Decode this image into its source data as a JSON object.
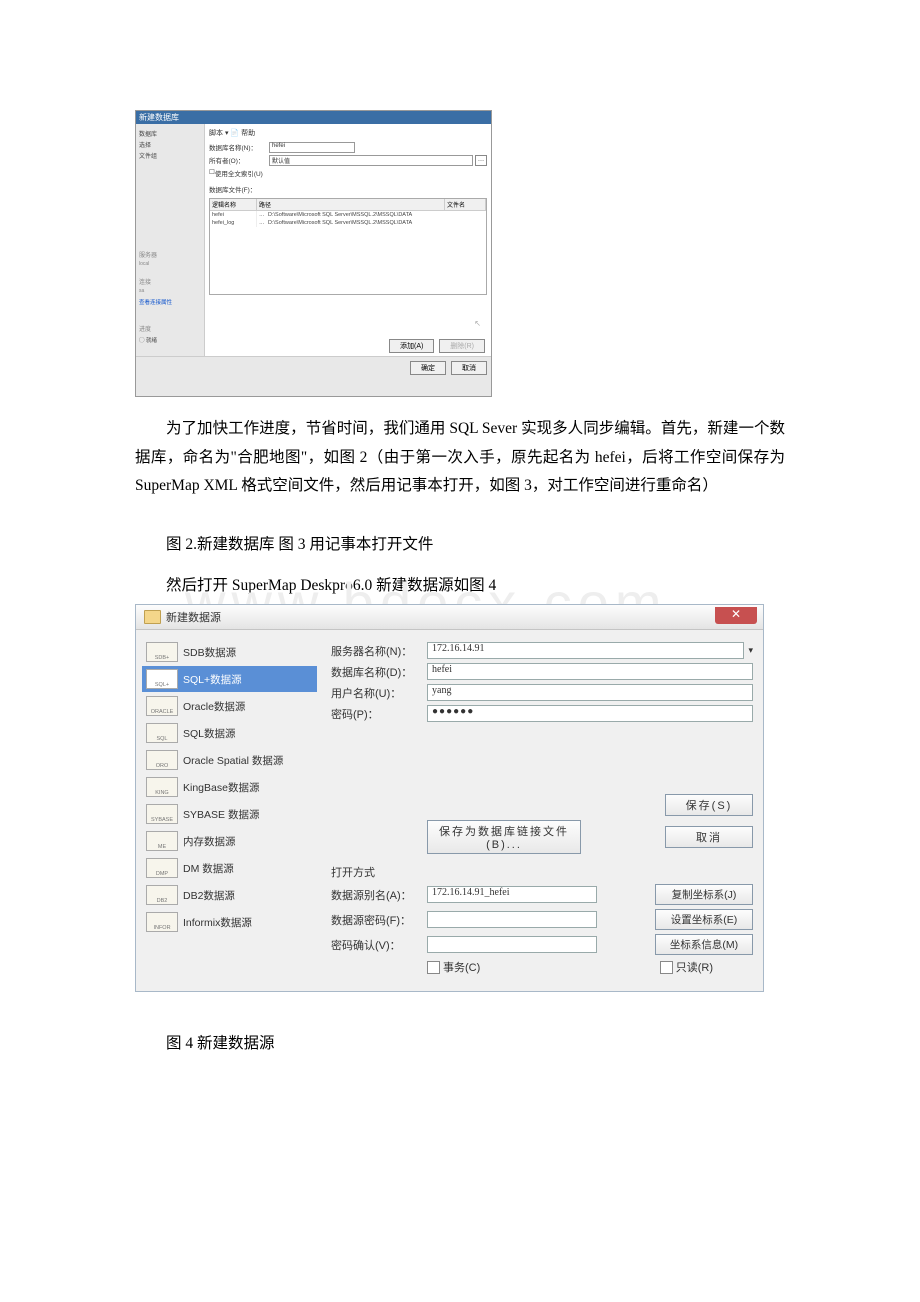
{
  "fig1": {
    "window_title": "新建数据库",
    "tree": [
      "数据库",
      "选择",
      "文件组"
    ],
    "tabs": "脚本 ▾ 📄 帮助",
    "form": {
      "name_label": "数据库名称(N)：",
      "name_value": "hefei",
      "owner_label": "所有者(O)：",
      "owner_value": "默认值",
      "fulltext_label": "使用全文索引(U)",
      "files_label": "数据库文件(F)："
    },
    "cols": {
      "logic": "逻辑名称",
      "type": "路径",
      "size": "文件名"
    },
    "rows": [
      {
        "n": "hefei",
        "p": "D:\\Software\\Microsoft SQL Server\\MSSQL.2\\MSSQL\\DATA"
      },
      {
        "n": "hefei_log",
        "p": "D:\\Software\\Microsoft SQL Server\\MSSQL.2\\MSSQL\\DATA"
      }
    ],
    "left2": {
      "srv": "服务器",
      "local": "连接",
      "adm": "sa",
      "view": "查看连接属性",
      "prog": "就绪"
    },
    "btns": {
      "add": "添加(A)",
      "del": "删除(R)",
      "ok": "确定",
      "cancel": "取消"
    }
  },
  "para1": "为了加快工作进度，节省时间，我们通用 SQL Sever 实现多人同步编辑。首先，新建一个数据库，命名为\"合肥地图\"，如图 2（由于第一次入手，原先起名为 hefei，后将工作空间保存为 SuperMap XML 格式空间文件，然后用记事本打开，如图 3，对工作空间进行重命名）",
  "cap_23": "图 2.新建数据库 图 3 用记事本打开文件",
  "para2": "然后打开 SuperMap Deskpro6.0 新建数据源如图 4",
  "watermark": "www.bdocx.com",
  "fig4": {
    "title": "新建数据源",
    "close": "✕",
    "ds_list": [
      {
        "icon": "SDB+",
        "label": "SDB数据源"
      },
      {
        "icon": "SQL+",
        "label": "SQL+数据源"
      },
      {
        "icon": "ORACLE",
        "label": "Oracle数据源"
      },
      {
        "icon": "SQL",
        "label": "SQL数据源"
      },
      {
        "icon": "ORO",
        "label": "Oracle Spatial 数据源"
      },
      {
        "icon": "KING",
        "label": "KingBase数据源"
      },
      {
        "icon": "SYBASE",
        "label": "SYBASE 数据源"
      },
      {
        "icon": "ME",
        "label": "内存数据源"
      },
      {
        "icon": "DMP",
        "label": "DM 数据源"
      },
      {
        "icon": "DB2",
        "label": "DB2数据源"
      },
      {
        "icon": "INFOR",
        "label": "Informix数据源"
      }
    ],
    "labels": {
      "server": "服务器名称(N)：",
      "server_v": "172.16.14.91",
      "db": "数据库名称(D)：",
      "db_v": "hefei",
      "user": "用户名称(U)：",
      "user_v": "yang",
      "pwd": "密码(P)：",
      "pwd_v": "●●●●●●",
      "save": "保存(S)",
      "cancel": "取消",
      "savelink": "保存为数据库链接文件(B)...",
      "open": "打开方式",
      "alias": "数据源别名(A)：",
      "alias_v": "172.16.14.91_hefei",
      "dspwd": "数据源密码(F)：",
      "pwdcfm": "密码确认(V)：",
      "copy": "复制坐标系(J)",
      "set": "设置坐标系(E)",
      "info": "坐标系信息(M)",
      "trans": "事务(C)",
      "readonly": "只读(R)"
    }
  },
  "cap_4": "图 4 新建数据源"
}
